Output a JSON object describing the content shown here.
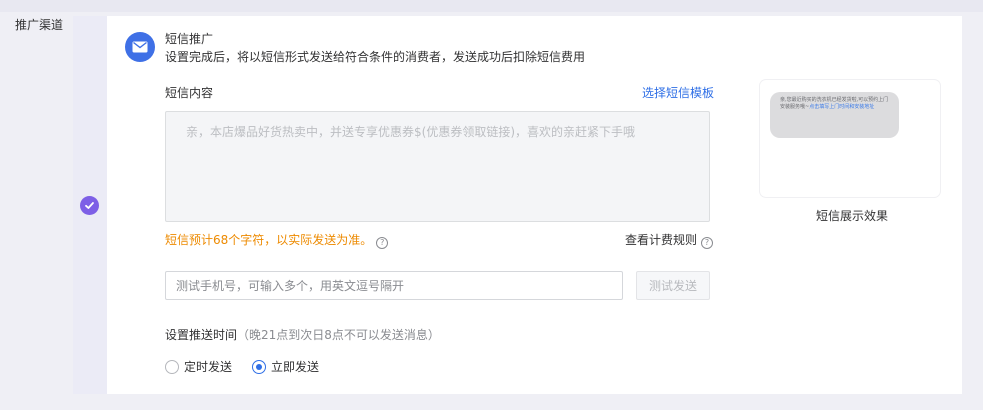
{
  "left_label": "推广渠道",
  "section": {
    "title": "短信推广",
    "desc": "设置完成后，将以短信形式发送给符合条件的消费者，发送成功后扣除短信费用"
  },
  "content": {
    "label": "短信内容",
    "template_link": "选择短信模板",
    "textarea_value": "亲，本店爆品好货热卖中，并送专享优惠券$(优惠券领取链接)，喜欢的亲赶紧下手哦",
    "count_note": "短信预计68个字符，以实际发送为准。",
    "billing_link": "查看计费规则"
  },
  "test": {
    "placeholder": "测试手机号，可输入多个，用英文逗号隔开",
    "send_label": "测试发送"
  },
  "time": {
    "label": "设置推送时间",
    "hint": "（晚21点到次日8点不可以发送消息）",
    "options": [
      {
        "label": "定时发送",
        "selected": false
      },
      {
        "label": "立即发送",
        "selected": true
      }
    ]
  },
  "preview": {
    "bubble_text": "亲,您最近购买的洗衣机已经发货啦,可以预约上门安装服务哦~",
    "bubble_link": "点击填写上门时间和安装地址",
    "caption": "短信展示效果"
  },
  "icons": {
    "sms": "envelope-icon",
    "check": "check-circle-icon",
    "help": "question-circle-icon"
  },
  "colors": {
    "accent": "#3f70e6",
    "check": "#7d5fe6",
    "warning": "#ed8a00",
    "link": "#2f6fe6"
  }
}
